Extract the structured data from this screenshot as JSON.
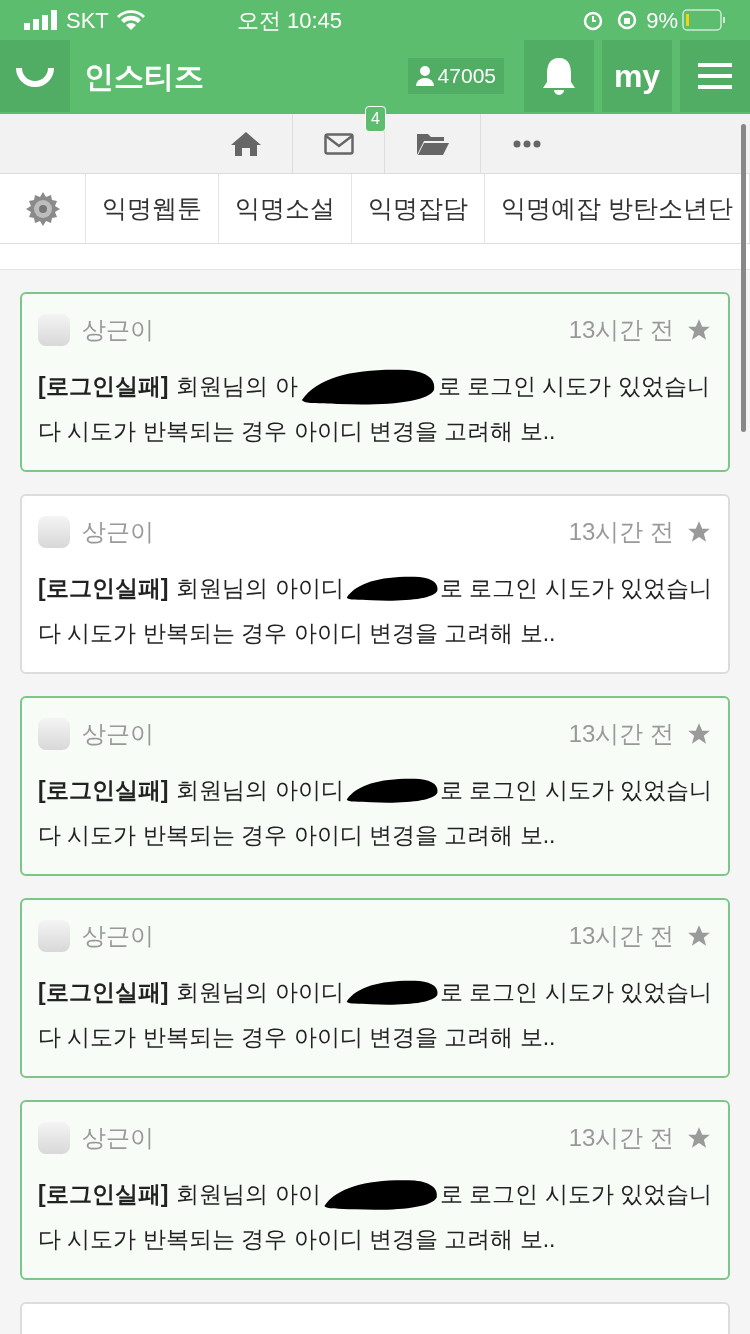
{
  "status_bar": {
    "carrier": "SKT",
    "time": "오전 10:45",
    "battery": "9%"
  },
  "header": {
    "title": "인스티즈",
    "user_count": "47005",
    "my_label": "my"
  },
  "nav": {
    "mail_badge": "4"
  },
  "categories": [
    "익명웹툰",
    "익명소설",
    "익명잡담",
    "익명예잡 방탄소년단"
  ],
  "notifications": [
    {
      "unread": true,
      "author": "상근이",
      "time": "13시간 전",
      "tag": "[로그인실패]",
      "before": "회원님의 아",
      "after": "로 로그인 시도가 있었습니",
      "line2": "다 시도가 반복되는 경우 아이디 변경을 고려해 보.."
    },
    {
      "unread": false,
      "author": "상근이",
      "time": "13시간 전",
      "tag": "[로그인실패]",
      "before": "회원님의 아이디",
      "after": "로 로그인 시도가 있었습니",
      "line2": "다 시도가 반복되는 경우 아이디 변경을 고려해 보.."
    },
    {
      "unread": true,
      "author": "상근이",
      "time": "13시간 전",
      "tag": "[로그인실패]",
      "before": "회원님의 아이디",
      "after": "로 로그인 시도가 있었습니",
      "line2": "다 시도가 반복되는 경우 아이디 변경을 고려해 보.."
    },
    {
      "unread": true,
      "author": "상근이",
      "time": "13시간 전",
      "tag": "[로그인실패]",
      "before": "회원님의 아이디",
      "after": "로 로그인 시도가 있었습니",
      "line2": "다 시도가 반복되는 경우 아이디 변경을 고려해 보.."
    },
    {
      "unread": true,
      "author": "상근이",
      "time": "13시간 전",
      "tag": "[로그인실패]",
      "before": "회원님의 아이",
      "after": "로 로그인 시도가 있었습니",
      "line2": "다 시도가 반복되는 경우 아이디 변경을 고려해 보.."
    },
    {
      "unread": false
    }
  ]
}
